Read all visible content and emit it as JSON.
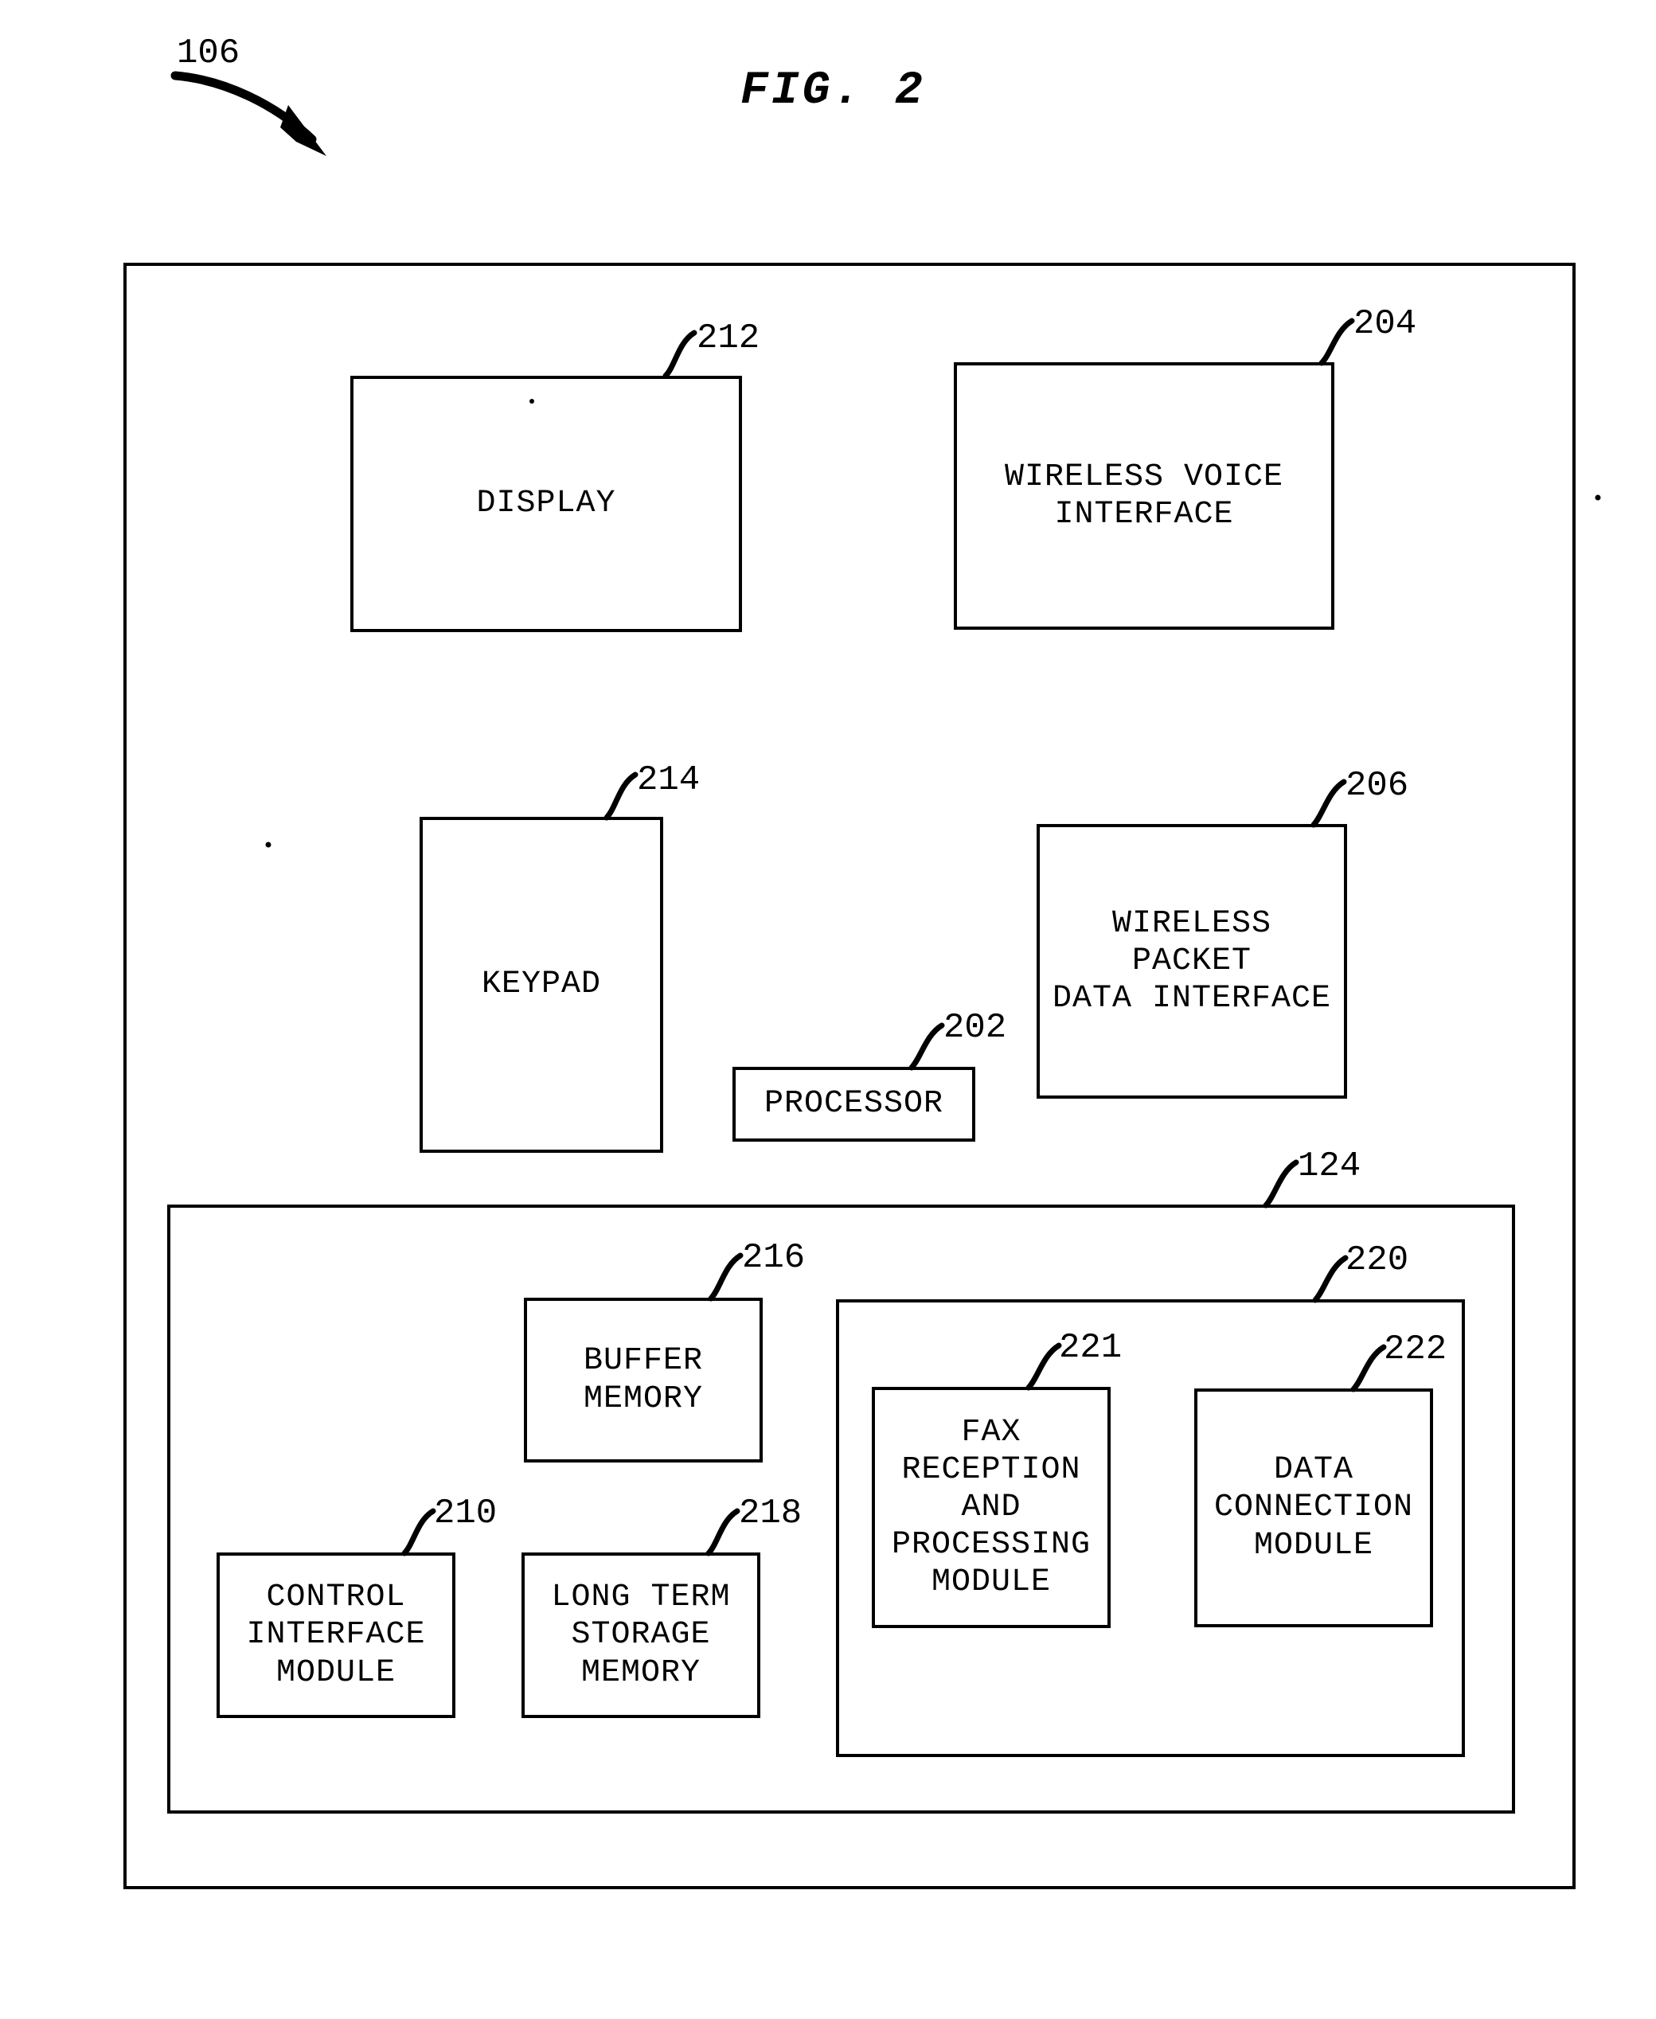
{
  "figure": {
    "title": "FIG. 2",
    "root_reference": "106"
  },
  "diagram": {
    "type": "patent-block-diagram",
    "outer_container": {
      "reference": null,
      "name": "device-outline"
    },
    "blocks": [
      {
        "id": "display",
        "reference": "212",
        "label": "DISPLAY"
      },
      {
        "id": "wireless-voice",
        "reference": "204",
        "label": "WIRELESS VOICE INTERFACE"
      },
      {
        "id": "keypad",
        "reference": "214",
        "label": "KEYPAD"
      },
      {
        "id": "wireless-packet",
        "reference": "206",
        "label": "WIRELESS PACKET\nDATA INTERFACE"
      },
      {
        "id": "processor",
        "reference": "202",
        "label": "PROCESSOR"
      },
      {
        "id": "memory-group",
        "reference": "124",
        "label": ""
      },
      {
        "id": "buffer-memory",
        "reference": "216",
        "label": "BUFFER MEMORY"
      },
      {
        "id": "control-interface",
        "reference": "210",
        "label": "CONTROL\nINTERFACE\nMODULE"
      },
      {
        "id": "long-term-storage",
        "reference": "218",
        "label": "LONG TERM\nSTORAGE\nMEMORY"
      },
      {
        "id": "module-group",
        "reference": "220",
        "label": ""
      },
      {
        "id": "fax-reception",
        "reference": "221",
        "label": "FAX\nRECEPTION\nAND\nPROCESSING\nMODULE"
      },
      {
        "id": "data-connection",
        "reference": "222",
        "label": "DATA\nCONNECTION\nMODULE"
      }
    ]
  },
  "colors": {
    "ink": "#000000",
    "paper": "#ffffff"
  }
}
